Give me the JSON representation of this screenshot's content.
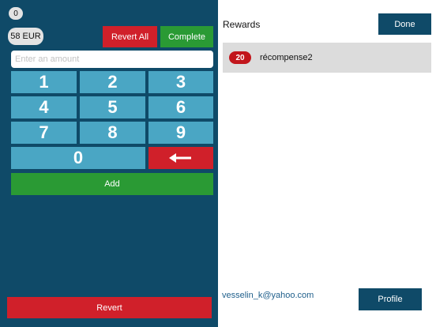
{
  "keypad": {
    "counter": "0",
    "balance": "58 EUR",
    "revert_all_label": "Revert All",
    "complete_label": "Complete",
    "amount_placeholder": "Enter an amount",
    "keys": [
      "1",
      "2",
      "3",
      "4",
      "5",
      "6",
      "7",
      "8",
      "9",
      "0"
    ],
    "backspace_icon": "arrow-left-icon",
    "add_label": "Add",
    "revert_label": "Revert"
  },
  "rewards": {
    "title": "Rewards",
    "done_label": "Done",
    "items": [
      {
        "points": "20",
        "name": "récompense2"
      }
    ]
  },
  "account": {
    "email": "vesselin_k@yahoo.com",
    "profile_label": "Profile"
  },
  "colors": {
    "panel": "#0f4a68",
    "key": "#4aa6c4",
    "danger": "#d0202a",
    "success": "#2a9a34",
    "reward_row": "#dcdcdc",
    "badge": "#c2161c"
  }
}
